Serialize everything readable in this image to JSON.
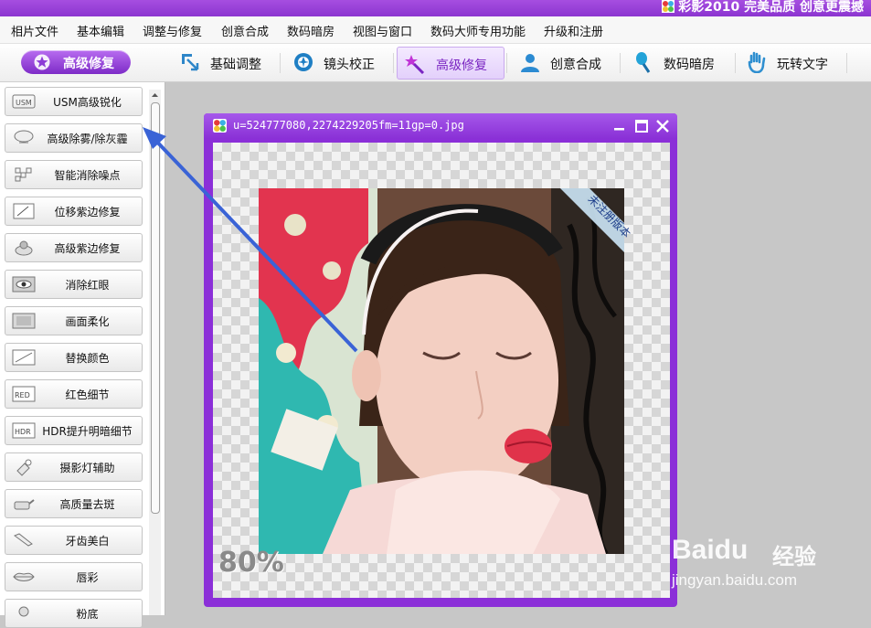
{
  "app": {
    "title": "彩影2010 完美品质 创意更震撼"
  },
  "menu": [
    {
      "label": "相片文件"
    },
    {
      "label": "基本编辑"
    },
    {
      "label": "调整与修复"
    },
    {
      "label": "创意合成"
    },
    {
      "label": "数码暗房"
    },
    {
      "label": "视图与窗口"
    },
    {
      "label": "数码大师专用功能"
    },
    {
      "label": "升级和注册"
    }
  ],
  "toolbar": {
    "mode_button": "高级修复",
    "tabs": [
      {
        "label": "基础调整",
        "icon": "crop-arrow-icon",
        "active": false
      },
      {
        "label": "镜头校正",
        "icon": "lens-icon",
        "active": false
      },
      {
        "label": "高级修复",
        "icon": "magic-wand-icon",
        "active": true
      },
      {
        "label": "创意合成",
        "icon": "person-icon",
        "active": false
      },
      {
        "label": "数码暗房",
        "icon": "brush-icon",
        "active": false
      },
      {
        "label": "玩转文字",
        "icon": "hand-icon",
        "active": false
      }
    ]
  },
  "sidebar": {
    "items": [
      {
        "label": "USM高级锐化",
        "icon": "usm-icon"
      },
      {
        "label": "高级除雾/除灰霾",
        "icon": "fog-icon"
      },
      {
        "label": "智能消除噪点",
        "icon": "noise-icon"
      },
      {
        "label": "位移紫边修复",
        "icon": "edge-icon"
      },
      {
        "label": "高级紫边修复",
        "icon": "purple-fringe-icon"
      },
      {
        "label": "消除红眼",
        "icon": "eye-icon"
      },
      {
        "label": "画面柔化",
        "icon": "soften-icon"
      },
      {
        "label": "替换颜色",
        "icon": "color-replace-icon"
      },
      {
        "label": "红色细节",
        "icon": "red-detail-icon"
      },
      {
        "label": "HDR提升明暗细节",
        "icon": "hdr-icon"
      },
      {
        "label": "摄影灯辅助",
        "icon": "flashlight-icon"
      },
      {
        "label": "高质量去斑",
        "icon": "spot-removal-icon"
      },
      {
        "label": "牙齿美白",
        "icon": "tooth-icon"
      },
      {
        "label": "唇彩",
        "icon": "lips-icon"
      },
      {
        "label": "粉底",
        "icon": "foundation-icon"
      }
    ]
  },
  "image_window": {
    "filename": "u=524777080,2274229205fm=11gp=0.jpg",
    "zoom": "80%",
    "ribbon": "未注册版本"
  },
  "watermark": {
    "logo": "Baidu",
    "cn": "经验",
    "url": "jingyan.baidu.com"
  },
  "colors": {
    "accent": "#8b2fd8",
    "annotation_arrow": "#3a63d6"
  }
}
